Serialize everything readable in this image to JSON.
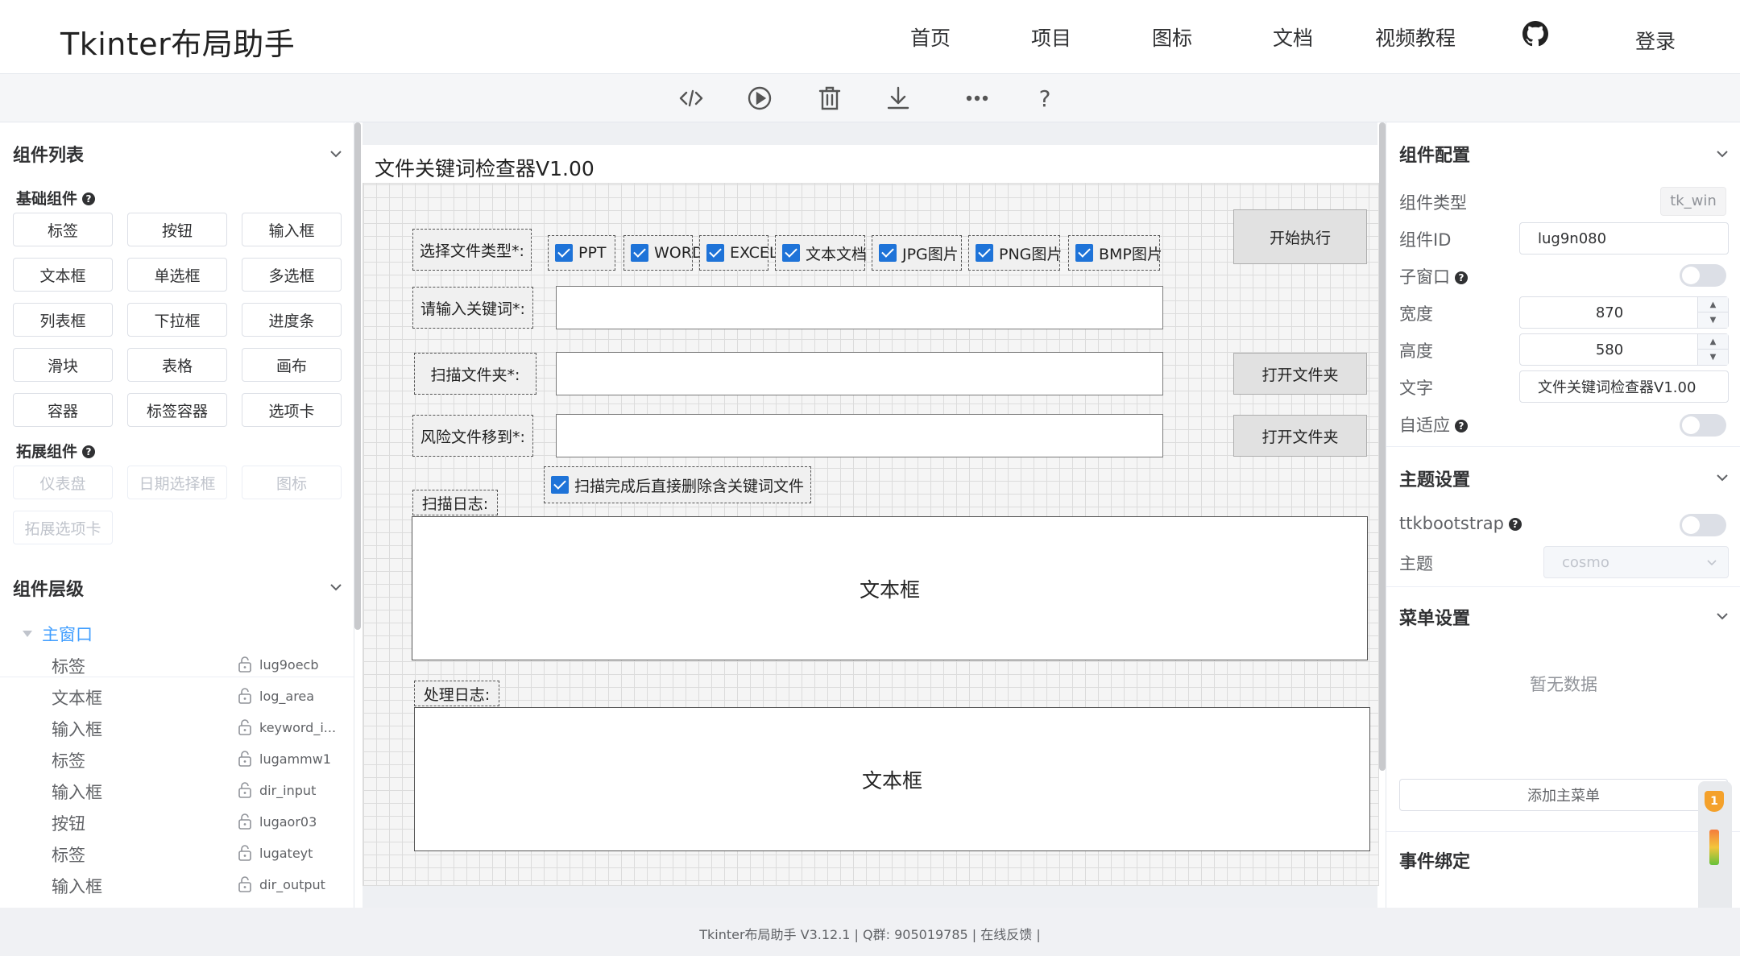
{
  "brand": "Tkinter布局助手",
  "nav": {
    "items": [
      "首页",
      "项目",
      "图标",
      "文档",
      "视频教程"
    ],
    "login": "登录"
  },
  "toolbar": {
    "icons": [
      "code-icon",
      "play-icon",
      "trash-icon",
      "download-icon",
      "more-icon",
      "help-icon"
    ],
    "help_glyph": "?"
  },
  "left": {
    "components_title": "组件列表",
    "basic_title": "基础组件",
    "basic_items": [
      "标签",
      "按钮",
      "输入框",
      "文本框",
      "单选框",
      "多选框",
      "列表框",
      "下拉框",
      "进度条",
      "滑块",
      "表格",
      "画布",
      "容器",
      "标签容器",
      "选项卡"
    ],
    "ext_title": "拓展组件",
    "ext_items": [
      "仪表盘",
      "日期选择框",
      "图标",
      "拓展选项卡"
    ],
    "hierarchy_title": "组件层级",
    "root": "主窗口",
    "tree": [
      {
        "label": "标签",
        "id": "lug9oecb"
      },
      {
        "label": "文本框",
        "id": "log_area"
      },
      {
        "label": "输入框",
        "id": "keyword_i..."
      },
      {
        "label": "标签",
        "id": "lugammw1"
      },
      {
        "label": "输入框",
        "id": "dir_input"
      },
      {
        "label": "按钮",
        "id": "lugaor03"
      },
      {
        "label": "标签",
        "id": "lugateyt"
      },
      {
        "label": "输入框",
        "id": "dir_output"
      }
    ]
  },
  "canvas": {
    "title": "文件关键词检查器V1.00",
    "file_type_label": "选择文件类型*:",
    "checkboxes": [
      "PPT",
      "WORD",
      "EXCEL",
      "文本文档",
      "JPG图片",
      "PNG图片",
      "BMP图片"
    ],
    "start_button": "开始执行",
    "keyword_label": "请输入关键词*:",
    "scan_label": "扫描文件夹*:",
    "open_folder_1": "打开文件夹",
    "risk_label": "风险文件移到*:",
    "open_folder_2": "打开文件夹",
    "delete_check": "扫描完成后直接删除含关键词文件",
    "scan_log_label": "扫描日志:",
    "text_box_1": "文本框",
    "process_log_label": "处理日志:",
    "text_box_2": "文本框"
  },
  "right": {
    "config_title": "组件配置",
    "type_label": "组件类型",
    "type_value": "tk_win",
    "id_label": "组件ID",
    "id_value": "lug9n080",
    "subwin_label": "子窗口",
    "width_label": "宽度",
    "width_value": "870",
    "height_label": "高度",
    "height_value": "580",
    "text_label": "文字",
    "text_value": "文件关键词检查器V1.00",
    "auto_label": "自适应",
    "theme_title": "主题设置",
    "ttk_label": "ttkbootstrap",
    "theme_label": "主题",
    "theme_value": "cosmo",
    "menu_title": "菜单设置",
    "empty": "暂无数据",
    "add_menu": "添加主菜单",
    "event_title": "事件绑定",
    "badge": "1"
  },
  "footer": "Tkinter布局助手 V3.12.1 | Q群: 905019785 | 在线反馈 |"
}
